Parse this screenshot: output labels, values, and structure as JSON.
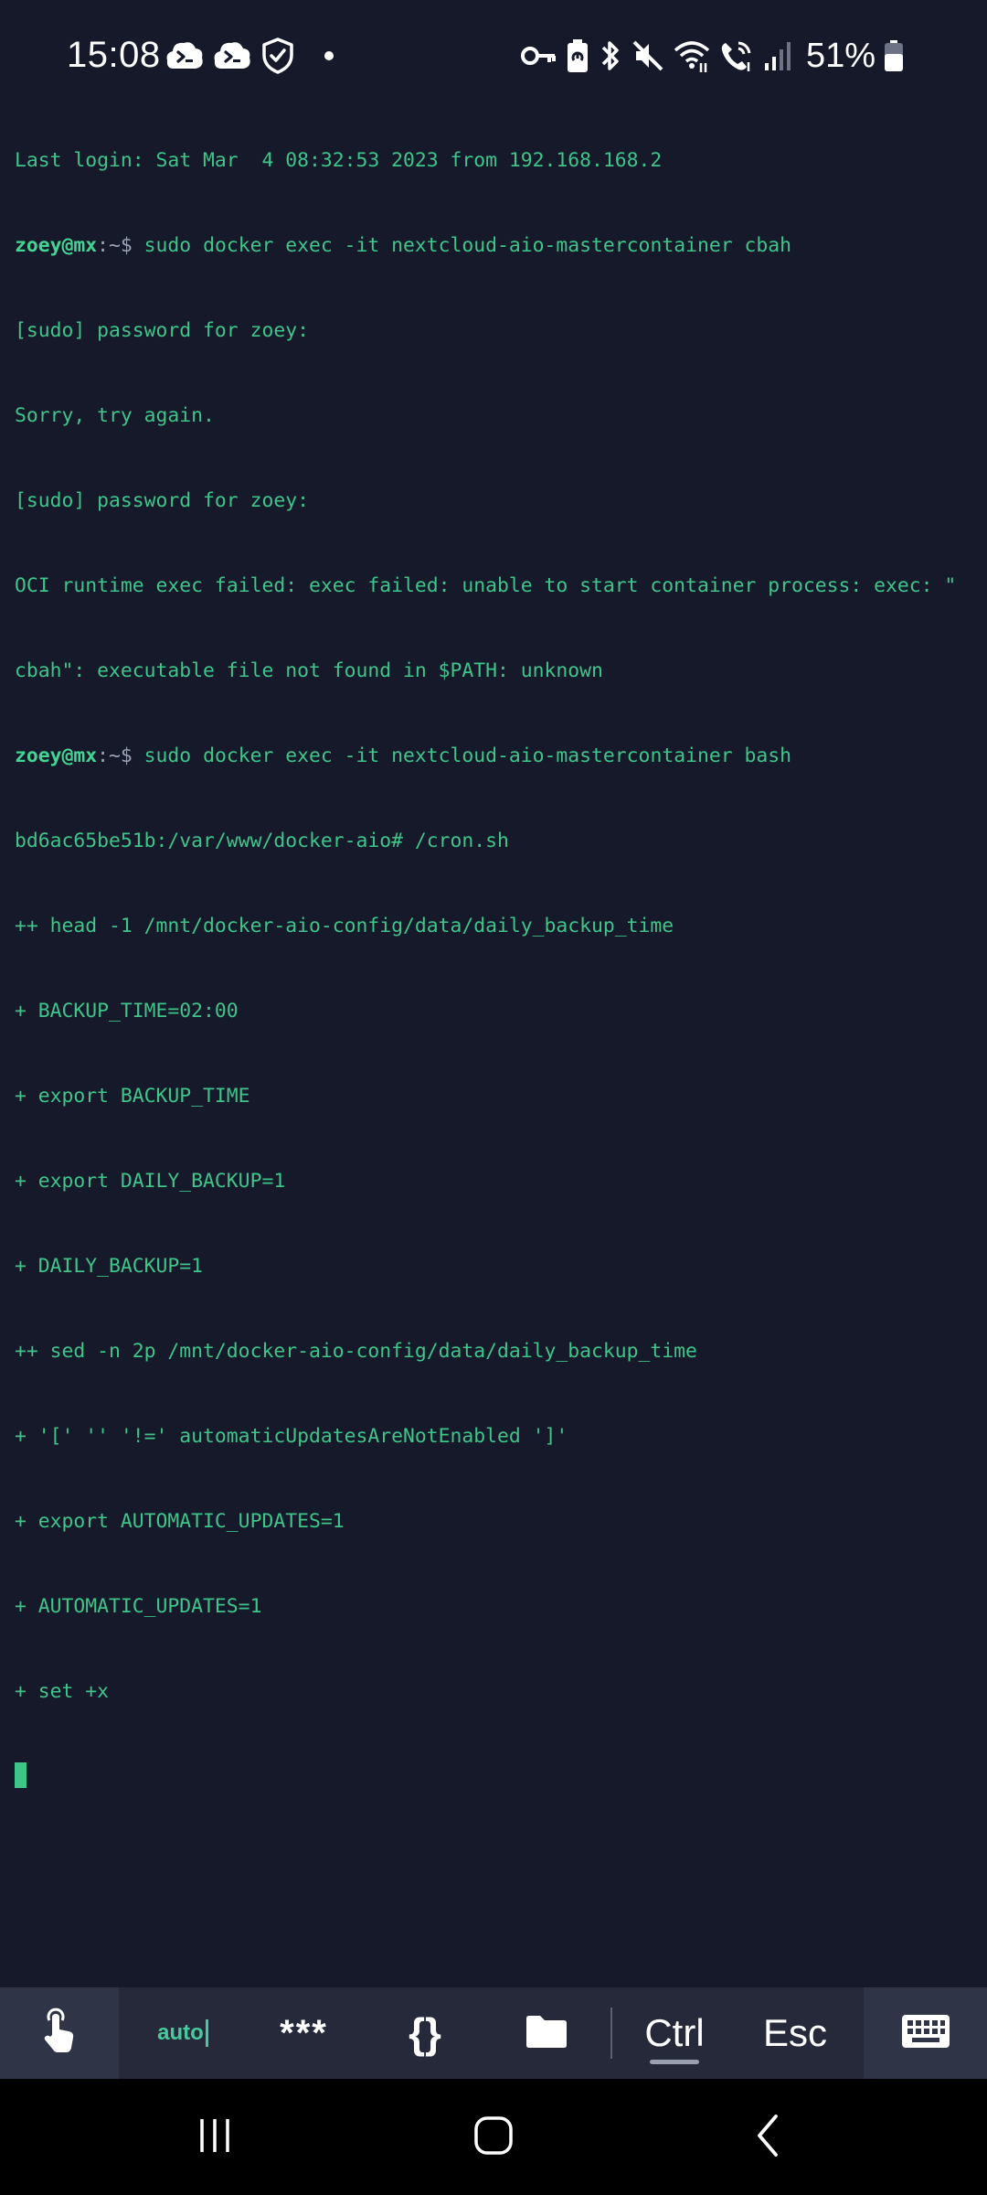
{
  "status_bar": {
    "time": "15:08",
    "battery_percent": "51%",
    "icons": [
      "terminal-app-icon",
      "terminal-app-icon",
      "shield-check-icon",
      "notification-dot-icon",
      "key-icon",
      "battery-saver-icon",
      "bluetooth-icon",
      "mute-icon",
      "wifi-icon",
      "wifi-calling-icon",
      "signal-icon",
      "battery-icon"
    ]
  },
  "terminal": {
    "lines": [
      "Last login: Sat Mar  4 08:32:53 2023 from 192.168.168.2",
      "zoey@mx:~$ sudo docker exec -it nextcloud-aio-mastercontainer cbah",
      "[sudo] password for zoey:",
      "Sorry, try again.",
      "[sudo] password for zoey:",
      "OCI runtime exec failed: exec failed: unable to start container process: exec: \"",
      "cbah\": executable file not found in $PATH: unknown",
      "zoey@mx:~$ sudo docker exec -it nextcloud-aio-mastercontainer bash",
      "bd6ac65be51b:/var/www/docker-aio# /cron.sh",
      "++ head -1 /mnt/docker-aio-config/data/daily_backup_time",
      "+ BACKUP_TIME=02:00",
      "+ export BACKUP_TIME",
      "+ export DAILY_BACKUP=1",
      "+ DAILY_BACKUP=1",
      "++ sed -n 2p /mnt/docker-aio-config/data/daily_backup_time",
      "+ '[' '' '!=' automaticUpdatesAreNotEnabled ']'",
      "+ export AUTOMATIC_UPDATES=1",
      "+ AUTOMATIC_UPDATES=1",
      "+ set +x"
    ],
    "prompt_user": "zoey@mx",
    "prompt_suffix": ":~$",
    "cmd1": " sudo docker exec -it nextcloud-aio-mastercontainer cbah",
    "cmd2": " sudo docker exec -it nextcloud-aio-mastercontainer bash"
  },
  "toolbar": {
    "auto_label": "auto",
    "password_label": "***",
    "snippets_label": "{}",
    "ctrl_label": "Ctrl",
    "esc_label": "Esc",
    "icons": [
      "touch-icon",
      "folder-icon",
      "keyboard-icon"
    ]
  },
  "colors": {
    "background": "#15192a",
    "terminal_text": "#3fc48a",
    "toolbar": "#25293a",
    "accent": "#48c99c"
  }
}
